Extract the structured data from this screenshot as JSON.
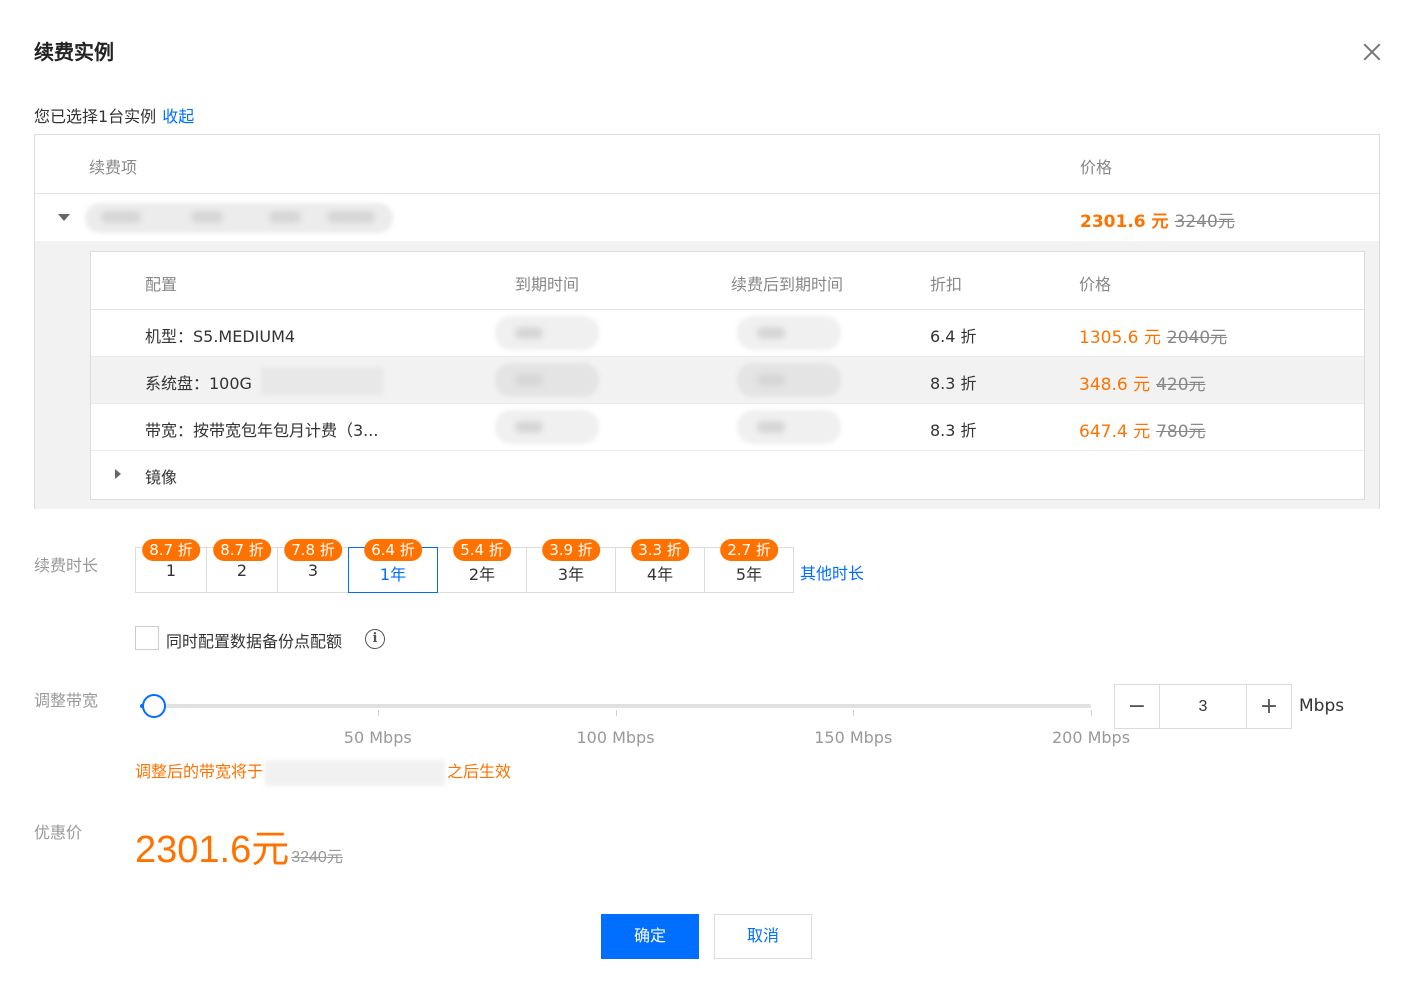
{
  "dialog": {
    "title": "续费实例",
    "close_icon": "close-icon"
  },
  "selection": {
    "text": "您已选择1台实例",
    "collapse_link": "收起"
  },
  "outer_table": {
    "headers": {
      "item": "续费项",
      "price": "价格"
    },
    "instance_row": {
      "price": "2301.6 元",
      "original_price": "3240元"
    }
  },
  "sub_table": {
    "headers": {
      "config": "配置",
      "expire": "到期时间",
      "expire_after": "续费后到期时间",
      "discount": "折扣",
      "price": "价格"
    },
    "rows": [
      {
        "config": "机型：S5.MEDIUM4",
        "discount": "6.4 折",
        "price": "1305.6 元",
        "original_price": "2040元"
      },
      {
        "config": "系统盘：100G",
        "discount": "8.3 折",
        "price": "348.6 元",
        "original_price": "420元"
      },
      {
        "config": "带宽：按带宽包年包月计费（3...",
        "discount": "8.3 折",
        "price": "647.4 元",
        "original_price": "780元"
      }
    ],
    "image_row": {
      "label": "镜像"
    }
  },
  "duration": {
    "label": "续费时长",
    "options": [
      {
        "badge": "8.7 折",
        "label": "1"
      },
      {
        "badge": "8.7 折",
        "label": "2"
      },
      {
        "badge": "7.8 折",
        "label": "3"
      },
      {
        "badge": "6.4 折",
        "label": "1年",
        "selected": true
      },
      {
        "badge": "5.4 折",
        "label": "2年"
      },
      {
        "badge": "3.9 折",
        "label": "3年"
      },
      {
        "badge": "3.3 折",
        "label": "4年"
      },
      {
        "badge": "2.7 折",
        "label": "5年"
      }
    ],
    "other_link": "其他时长"
  },
  "backup": {
    "checked": false,
    "label": "同时配置数据备份点配额",
    "info_icon": "info-icon",
    "info_glyph": "i"
  },
  "bandwidth": {
    "label": "调整带宽",
    "slider": {
      "min": 0,
      "max": 200,
      "value": 3
    },
    "ticks": [
      "50 Mbps",
      "100 Mbps",
      "150 Mbps",
      "200 Mbps"
    ],
    "tick_values": [
      50,
      100,
      150,
      200
    ],
    "stepper": {
      "value": "3",
      "minus": "−",
      "plus": "+"
    },
    "unit": "Mbps",
    "notice_prefix": "调整后的带宽将于",
    "notice_suffix": "之后生效"
  },
  "discount_price": {
    "label": "优惠价",
    "price": "2301.6元",
    "original": "3240元"
  },
  "buttons": {
    "confirm": "确定",
    "cancel": "取消"
  },
  "colors": {
    "accent": "#006eff",
    "price": "#ff7200"
  }
}
